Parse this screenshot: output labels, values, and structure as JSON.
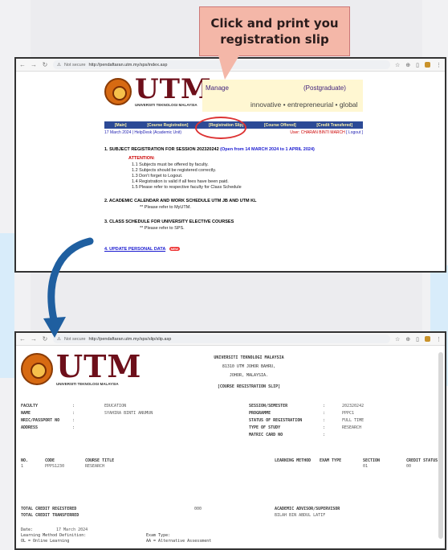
{
  "callout": {
    "line1": "Click and print you",
    "line2": "registration slip"
  },
  "window1": {
    "url": "http://pendaftaran.utm.my/sps/index.asp",
    "not_secure": "Not secure",
    "logo": "UTM",
    "logo_sub": "UNIVERSITI TEKNOLOGI MALAYSIA",
    "banner_title": "Manage",
    "banner_title2": "(Postgraduate)",
    "banner_tagline": "innovative • entrepreneurial • global",
    "nav": [
      "[Main]",
      "[Course Registration]",
      "[Registration Slip]",
      "[Course Offered]",
      "[Credit Transfered]"
    ],
    "date": "17 March 2024 | HelpDesk (Academic Unit)",
    "user_label": "User: CHARAN BINTI MARCH",
    "logout": "[ Logout ]",
    "section1": "1. SUBJECT REGISTRATION FOR SESSION 202320242",
    "section1_open": "(Open from 14 MARCH 2024 to 1 APRIL 2024)",
    "attention": "ATTENTION:",
    "rules": [
      "1.1  Subjects must be offered by faculty.",
      "1.2  Subjects should be registered correctly.",
      "1.3  Don't forget to Logout.",
      "1.4  Registration is valid if all fees have been paid.",
      "1.5  Please refer to respective faculty for Class Schedule"
    ],
    "section2": "2. ACADEMIC CALENDAR AND WORK SCHEDULE UTM JB AND UTM KL",
    "section2_note": "**  Please refer to MyUTM.",
    "section3": "3. CLASS SCHEDULE FOR UNIVERSITY ELECTIVE COURSES",
    "section3_note": "**  Please refer to SPS.",
    "section4": "4. UPDATE PERSONAL DATA",
    "new": "NEW"
  },
  "window2": {
    "url": "http://pendaftaran.utm.my/sps/slip/slip.asp",
    "not_secure": "Not secure",
    "logo": "UTM",
    "logo_sub": "UNIVERSITI TEKNOLOGI MALAYSIA",
    "univ": "UNIVERSITI TEKNOLOGI MALAYSIA",
    "addr1": "81310 UTM JOHOR BAHRU,",
    "addr2": "JOHOR, MALAYSIA.",
    "slip_title": "[COURSE REGISTRATION SLIP]",
    "left_fields": [
      {
        "k": "FACULTY",
        "v": "EDUCATION"
      },
      {
        "k": "NAME",
        "v": "SYAHIRA BINTI ANUMUN"
      },
      {
        "k": "NRIC/PASSPORT NO",
        "v": ""
      },
      {
        "k": "ADDRESS",
        "v": ""
      }
    ],
    "right_fields": [
      {
        "k": "SESSION/SEMESTER",
        "v": "202320242"
      },
      {
        "k": "PROGRAMME",
        "v": "PPPC1"
      },
      {
        "k": "STATUS OF REGISTRATION",
        "v": "FULL TIME"
      },
      {
        "k": "TYPE OF STUDY",
        "v": "RESEARCH"
      },
      {
        "k": "MATRIC CARD NO",
        "v": ""
      }
    ],
    "table_headers": [
      "NO.",
      "CODE",
      "COURSE TITLE",
      "LEARNING METHOD",
      "EXAM TYPE",
      "SECTION",
      "CREDIT STATUS"
    ],
    "row": {
      "no": "1",
      "code": "PPPS1230",
      "title": "RESEARCH",
      "section": "01",
      "credit": "00"
    },
    "total_registered": "TOTAL CREDIT REGISTERED",
    "total_registered_val": "000",
    "total_transferred": "TOTAL CREDIT TRANSFERRED",
    "advisor_label": "ACADEMIC ADVISOR/SUPERVISOR",
    "advisor_name": "BILAH BIN ABDUL LATIF",
    "date_label": "Date:",
    "date_val": "17 March 2024",
    "lm_def": "Learning Method Definition:",
    "lm_ol": "OL = Online Learning",
    "exam_type": "Exam Type:",
    "exam_aa": "AA = Alternative Assessment"
  }
}
